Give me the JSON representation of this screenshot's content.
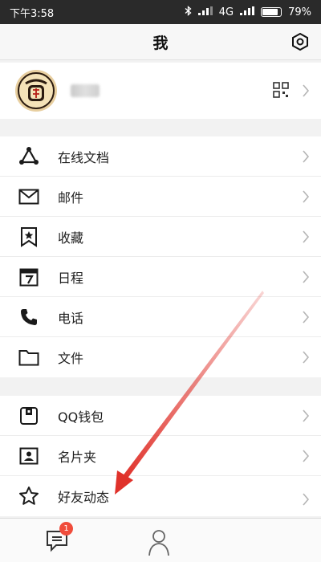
{
  "status_bar": {
    "time": "下午3:58",
    "network": "4G",
    "battery": "79%"
  },
  "header": {
    "title": "我"
  },
  "colors": {
    "accent_arrow": "#e0322b",
    "badge": "#f04c3b"
  },
  "icons": {
    "settings": "settings-icon",
    "qr": "qr-code-icon",
    "chevron": "chevron-right-icon"
  },
  "menu_group_1": [
    {
      "label": "在线文档",
      "icon": "online-doc-icon"
    },
    {
      "label": "邮件",
      "icon": "mail-icon"
    },
    {
      "label": "收藏",
      "icon": "bookmark-star-icon"
    },
    {
      "label": "日程",
      "icon": "calendar-icon"
    },
    {
      "label": "电话",
      "icon": "phone-icon"
    },
    {
      "label": "文件",
      "icon": "folder-icon"
    }
  ],
  "menu_group_2": [
    {
      "label": "QQ钱包",
      "icon": "wallet-icon"
    },
    {
      "label": "名片夹",
      "icon": "card-holder-icon"
    },
    {
      "label": "好友动态",
      "icon": "star-icon"
    }
  ],
  "tabbar": {
    "messages_badge": "1"
  }
}
